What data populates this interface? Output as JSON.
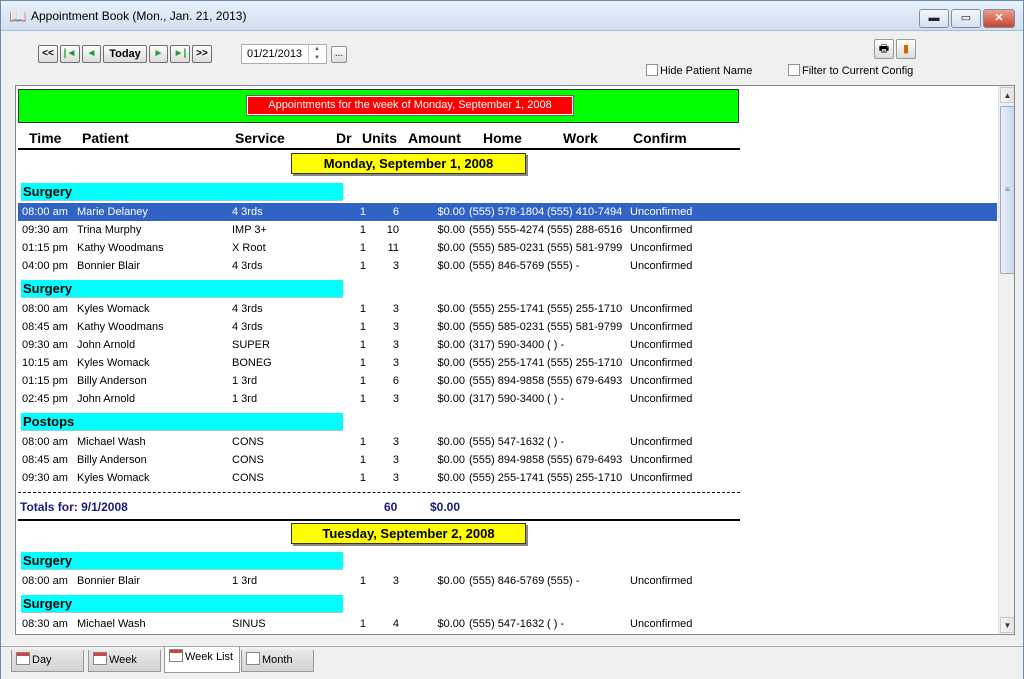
{
  "window": {
    "title": "Appointment Book (Mon., Jan. 21, 2013)",
    "minimize": "▬",
    "maximize": "▭",
    "close": "✕"
  },
  "toolbar": {
    "first": "<<",
    "prev_week": "|◄",
    "prev": "◄",
    "today": "Today",
    "next": "►",
    "next_week": "►|",
    "last": ">>",
    "date": "01/21/2013",
    "ellipsis": "...",
    "hide_patient_name": "Hide Patient Name",
    "filter_config": "Filter to Current Config"
  },
  "report": {
    "banner": "Appointments for the week of Monday, September 1, 2008",
    "columns": {
      "time": "Time",
      "patient": "Patient",
      "service": "Service",
      "dr": "Dr",
      "units": "Units",
      "amount": "Amount",
      "home": "Home",
      "work": "Work",
      "confirm": "Confirm"
    },
    "day1": "Monday, September 1, 2008",
    "day2": "Tuesday, September 2, 2008",
    "groups": [
      "Surgery",
      "Surgery",
      "Postops",
      "Surgery",
      "Surgery"
    ],
    "rows": [
      {
        "time": "08:00 am",
        "patient": "Marie Delaney",
        "service": "4 3rds",
        "dr": "1",
        "units": "6",
        "amount": "$0.00",
        "home": "(555) 578-1804",
        "work": "(555) 410-7494",
        "confirm": "Unconfirmed"
      },
      {
        "time": "09:30 am",
        "patient": "Trina Murphy",
        "service": "IMP 3+",
        "dr": "1",
        "units": "10",
        "amount": "$0.00",
        "home": "(555) 555-4274",
        "work": "(555) 288-6516",
        "confirm": "Unconfirmed"
      },
      {
        "time": "01:15 pm",
        "patient": "Kathy Woodmans",
        "service": "X Root",
        "dr": "1",
        "units": "11",
        "amount": "$0.00",
        "home": "(555) 585-0231",
        "work": "(555) 581-9799",
        "confirm": "Unconfirmed"
      },
      {
        "time": "04:00 pm",
        "patient": "Bonnier Blair",
        "service": "4 3rds",
        "dr": "1",
        "units": "3",
        "amount": "$0.00",
        "home": "(555) 846-5769",
        "work": "(555)   -",
        "confirm": "Unconfirmed"
      },
      {
        "time": "08:00 am",
        "patient": "Kyles Womack",
        "service": "4 3rds",
        "dr": "1",
        "units": "3",
        "amount": "$0.00",
        "home": "(555) 255-1741",
        "work": "(555) 255-1710",
        "confirm": "Unconfirmed"
      },
      {
        "time": "08:45 am",
        "patient": "Kathy Woodmans",
        "service": "4 3rds",
        "dr": "1",
        "units": "3",
        "amount": "$0.00",
        "home": "(555) 585-0231",
        "work": "(555) 581-9799",
        "confirm": "Unconfirmed"
      },
      {
        "time": "09:30 am",
        "patient": "John  Arnold",
        "service": "SUPER",
        "dr": "1",
        "units": "3",
        "amount": "$0.00",
        "home": "(317) 590-3400",
        "work": "(  )   -",
        "confirm": "Unconfirmed"
      },
      {
        "time": "10:15 am",
        "patient": "Kyles Womack",
        "service": "BONEG",
        "dr": "1",
        "units": "3",
        "amount": "$0.00",
        "home": "(555) 255-1741",
        "work": "(555) 255-1710",
        "confirm": "Unconfirmed"
      },
      {
        "time": "01:15 pm",
        "patient": "Billy Anderson",
        "service": "1 3rd",
        "dr": "1",
        "units": "6",
        "amount": "$0.00",
        "home": "(555) 894-9858",
        "work": "(555) 679-6493",
        "confirm": "Unconfirmed"
      },
      {
        "time": "02:45 pm",
        "patient": "John  Arnold",
        "service": "1 3rd",
        "dr": "1",
        "units": "3",
        "amount": "$0.00",
        "home": "(317) 590-3400",
        "work": "(  )   -",
        "confirm": "Unconfirmed"
      },
      {
        "time": "08:00 am",
        "patient": "Michael Wash",
        "service": "CONS",
        "dr": "1",
        "units": "3",
        "amount": "$0.00",
        "home": "(555) 547-1632",
        "work": "(  )   -",
        "confirm": "Unconfirmed"
      },
      {
        "time": "08:45 am",
        "patient": "Billy Anderson",
        "service": "CONS",
        "dr": "1",
        "units": "3",
        "amount": "$0.00",
        "home": "(555) 894-9858",
        "work": "(555) 679-6493",
        "confirm": "Unconfirmed"
      },
      {
        "time": "09:30 am",
        "patient": "Kyles Womack",
        "service": "CONS",
        "dr": "1",
        "units": "3",
        "amount": "$0.00",
        "home": "(555) 255-1741",
        "work": "(555) 255-1710",
        "confirm": "Unconfirmed"
      },
      {
        "time": "08:00 am",
        "patient": "Bonnier Blair",
        "service": "1 3rd",
        "dr": "1",
        "units": "3",
        "amount": "$0.00",
        "home": "(555) 846-5769",
        "work": "(555)   -",
        "confirm": "Unconfirmed"
      },
      {
        "time": "08:30 am",
        "patient": "Michael Wash",
        "service": "SINUS",
        "dr": "1",
        "units": "4",
        "amount": "$0.00",
        "home": "(555) 547-1632",
        "work": "(  )   -",
        "confirm": "Unconfirmed"
      }
    ],
    "totals": {
      "label": "Totals for:  9/1/2008",
      "units": "60",
      "amount": "$0.00"
    }
  },
  "tabs": [
    "Day",
    "Week",
    "Week List",
    "Month"
  ],
  "selected_tab": "Week List"
}
